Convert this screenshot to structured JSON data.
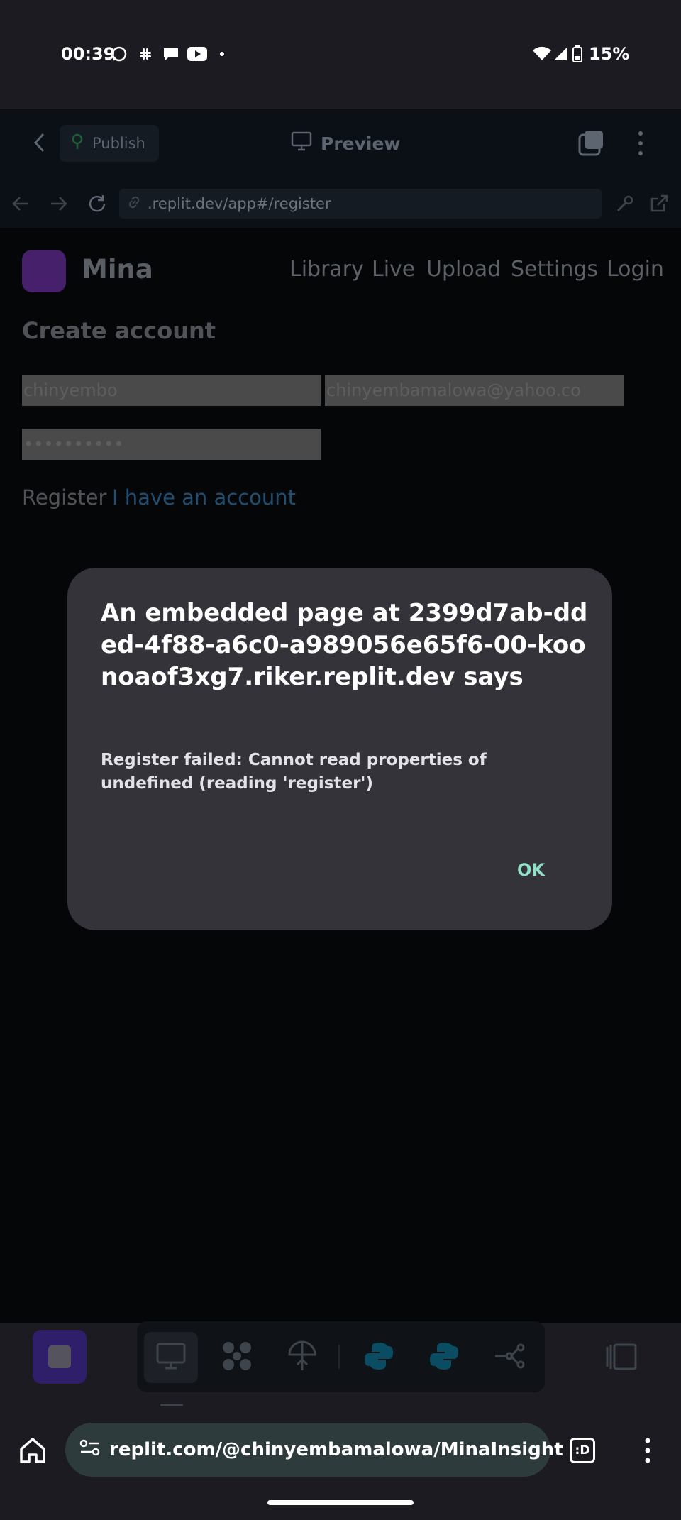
{
  "status_bar": {
    "time": "00:39",
    "battery": "15%"
  },
  "replit_bar": {
    "publish_label": "Publish",
    "preview_label": "Preview"
  },
  "url_bar": {
    "url": ".replit.dev/app#/register"
  },
  "app": {
    "brand": "Mina",
    "nav": [
      "Library",
      "Live",
      "Upload",
      "Settings",
      "Login"
    ],
    "heading": "Create account",
    "fields": {
      "username": "chinyembo",
      "email": "chinyembamalowa@yahoo.co",
      "password": "••••••••••"
    },
    "register_label": "Register",
    "have_account_label": "I have an account"
  },
  "dialog": {
    "title": "An embedded page at 2399d7ab-dded-4f88-a6c0-a989056e65f6-00-koonoaof3xg7.riker.replit.dev says",
    "message": "Register failed: Cannot read properties of undefined (reading 'register')",
    "ok_label": "OK"
  },
  "browser": {
    "omnibox_url": "replit.com/@chinyembamalowa/MinaInsight",
    "tab_label": ":D"
  },
  "colors": {
    "accent_purple": "#5b3db5",
    "dialog_bg": "#35333a",
    "ok_color": "#8fe0c7",
    "link_blue": "#1f4e73"
  }
}
